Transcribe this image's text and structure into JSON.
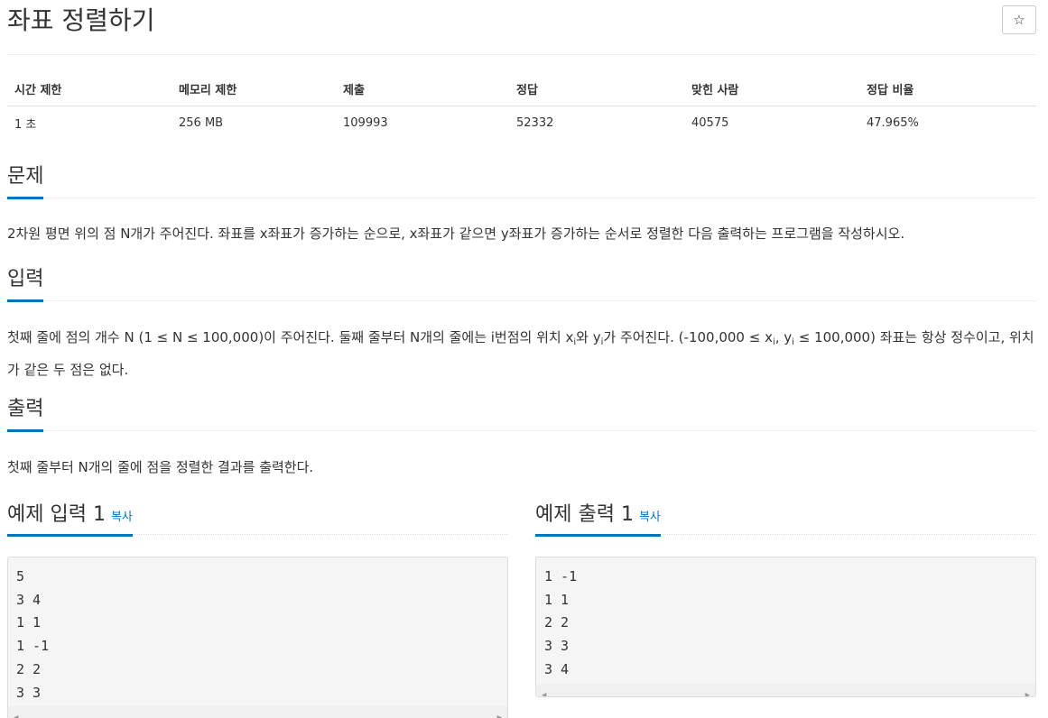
{
  "problem": {
    "title": "좌표 정렬하기",
    "star_icon": "☆"
  },
  "info_table": {
    "headers": [
      "시간 제한",
      "메모리 제한",
      "제출",
      "정답",
      "맞힌 사람",
      "정답 비율"
    ],
    "values": [
      "1 초",
      "256 MB",
      "109993",
      "52332",
      "40575",
      "47.965%"
    ]
  },
  "sections": {
    "description": {
      "title": "문제",
      "text": "2차원 평면 위의 점 N개가 주어진다. 좌표를 x좌표가 증가하는 순으로, x좌표가 같으면 y좌표가 증가하는 순서로 정렬한 다음 출력하는 프로그램을 작성하시오."
    },
    "input": {
      "title": "입력",
      "text_1": "첫째 줄에 점의 개수 N (1 ≤ N ≤ 100,000)이 주어진다. 둘째 줄부터 N개의 줄에는 i번점의 위치 x",
      "sub_i": "i",
      "text_2": "와 y",
      "text_3": "가 주어진다. (-100,000 ≤ x",
      "text_4": ", y",
      "text_5": " ≤ 100,000) 좌표는 항상 정수이고, 위치가 같은 두 점은 없다."
    },
    "output": {
      "title": "출력",
      "text": "첫째 줄부터 N개의 줄에 점을 정렬한 결과를 출력한다."
    }
  },
  "samples": {
    "input": {
      "title": "예제 입력 1",
      "copy_label": "복사",
      "content": "5\n3 4\n1 1\n1 -1\n2 2\n3 3"
    },
    "output": {
      "title": "예제 출력 1",
      "copy_label": "복사",
      "content": "1 -1\n1 1\n2 2\n3 3\n3 4"
    }
  },
  "colors": {
    "accent": "#0076c0",
    "text": "#333333",
    "code_bg": "#f5f5f5"
  }
}
